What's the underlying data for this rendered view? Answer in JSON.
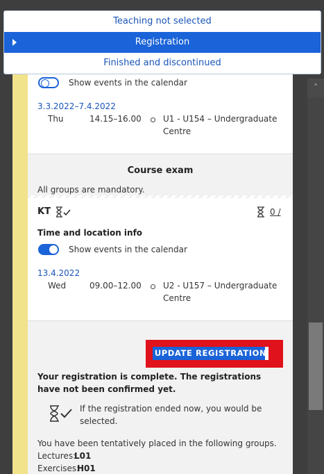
{
  "dropdown": {
    "items": [
      {
        "label": "Teaching not selected"
      },
      {
        "label": "Registration"
      },
      {
        "label": "Finished and discontinued"
      }
    ]
  },
  "group_top": {
    "calendar_label": "Show events in the calendar",
    "date_range": "3.3.2022–7.4.2022",
    "day": "Thu",
    "time": "14.15–16.00",
    "location_line1": "U1 - U154 – Undergraduate",
    "location_line2": "Centre"
  },
  "course_exam": {
    "title": "Course exam",
    "mandatory_note": "All groups are mandatory.",
    "group_code": "KT",
    "capacity": "0 /",
    "time_location_heading": "Time and location info",
    "calendar_label": "Show events in the calendar",
    "date": "13.4.2022",
    "day": "Wed",
    "time": "09.00–12.00",
    "location_line1": "U2 - U157 – Undergraduate",
    "location_line2": "Centre"
  },
  "summary": {
    "update_button": "UPDATE REGISTRATION",
    "complete_text": "Your registration is complete. The registrations have not been confirmed yet.",
    "ended_note": "If the registration ended now, you would be selected.",
    "placed_text": "You have been tentatively placed in the following groups.",
    "lectures_label": "Lectures:",
    "lectures_value": "L01",
    "exercises_label": "Exercises:",
    "exercises_value": "H01"
  },
  "colors": {
    "accent": "#1a63d8",
    "highlight_frame": "#e0121b",
    "stripe": "#f1e38c"
  }
}
